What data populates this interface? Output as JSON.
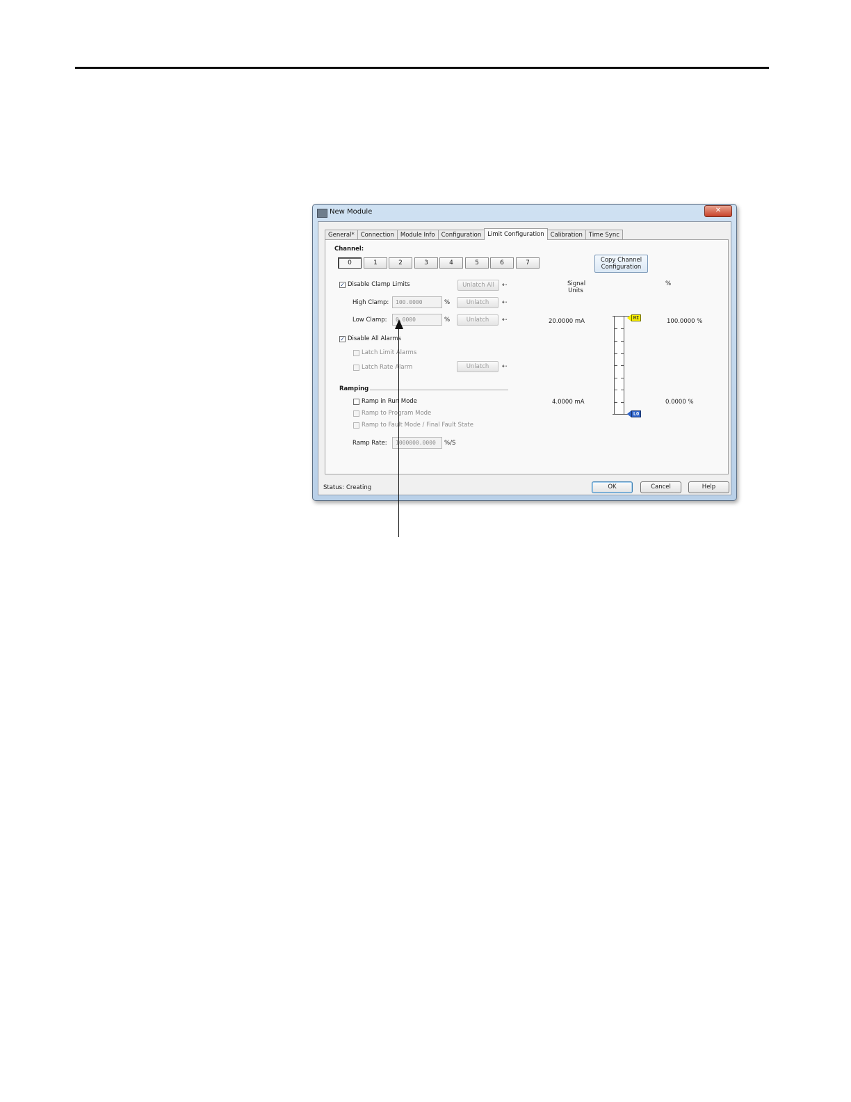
{
  "window": {
    "title": "New Module",
    "close_label": "✕"
  },
  "tabs": [
    {
      "label": "General*"
    },
    {
      "label": "Connection"
    },
    {
      "label": "Module Info"
    },
    {
      "label": "Configuration"
    },
    {
      "label": "Limit Configuration",
      "active": true
    },
    {
      "label": "Calibration"
    },
    {
      "label": "Time Sync"
    }
  ],
  "channel": {
    "label": "Channel:",
    "buttons": [
      "0",
      "1",
      "2",
      "3",
      "4",
      "5",
      "6",
      "7"
    ],
    "selected": "0",
    "copy_label_line1": "Copy Channel",
    "copy_label_line2": "Configuration"
  },
  "clamp": {
    "disable_label": "Disable Clamp Limits",
    "disable_checked": true,
    "unlatch_all_label": "Unlatch All",
    "high_label": "High Clamp:",
    "high_value": "100.0000",
    "low_label": "Low Clamp:",
    "low_value": "0.0000",
    "unit": "%",
    "unlatch_label": "Unlatch",
    "arrow_symbol": "⇠"
  },
  "alarms": {
    "disable_label": "Disable All Alarms",
    "disable_checked": true,
    "latch_limit_label": "Latch Limit Alarms",
    "latch_rate_label": "Latch Rate Alarm",
    "unlatch_label": "Unlatch"
  },
  "ramping": {
    "heading": "Ramping",
    "run_mode_label": "Ramp in Run Mode",
    "program_mode_label": "Ramp to Program Mode",
    "fault_mode_label": "Ramp to Fault Mode / Final Fault State",
    "rate_label": "Ramp Rate:",
    "rate_value": "1000000.0000",
    "rate_unit": "%/S"
  },
  "scale": {
    "signal_units_line1": "Signal",
    "signal_units_line2": "Units",
    "percent_header": "%",
    "high_signal": "20.0000 mA",
    "low_signal": "4.0000 mA",
    "high_percent": "100.0000 %",
    "low_percent": "0.0000 %",
    "hi_flag": "HI",
    "lo_flag": "LO"
  },
  "status": {
    "label": "Status:",
    "value": "Creating"
  },
  "buttons": {
    "ok": "OK",
    "cancel": "Cancel",
    "help": "Help"
  }
}
